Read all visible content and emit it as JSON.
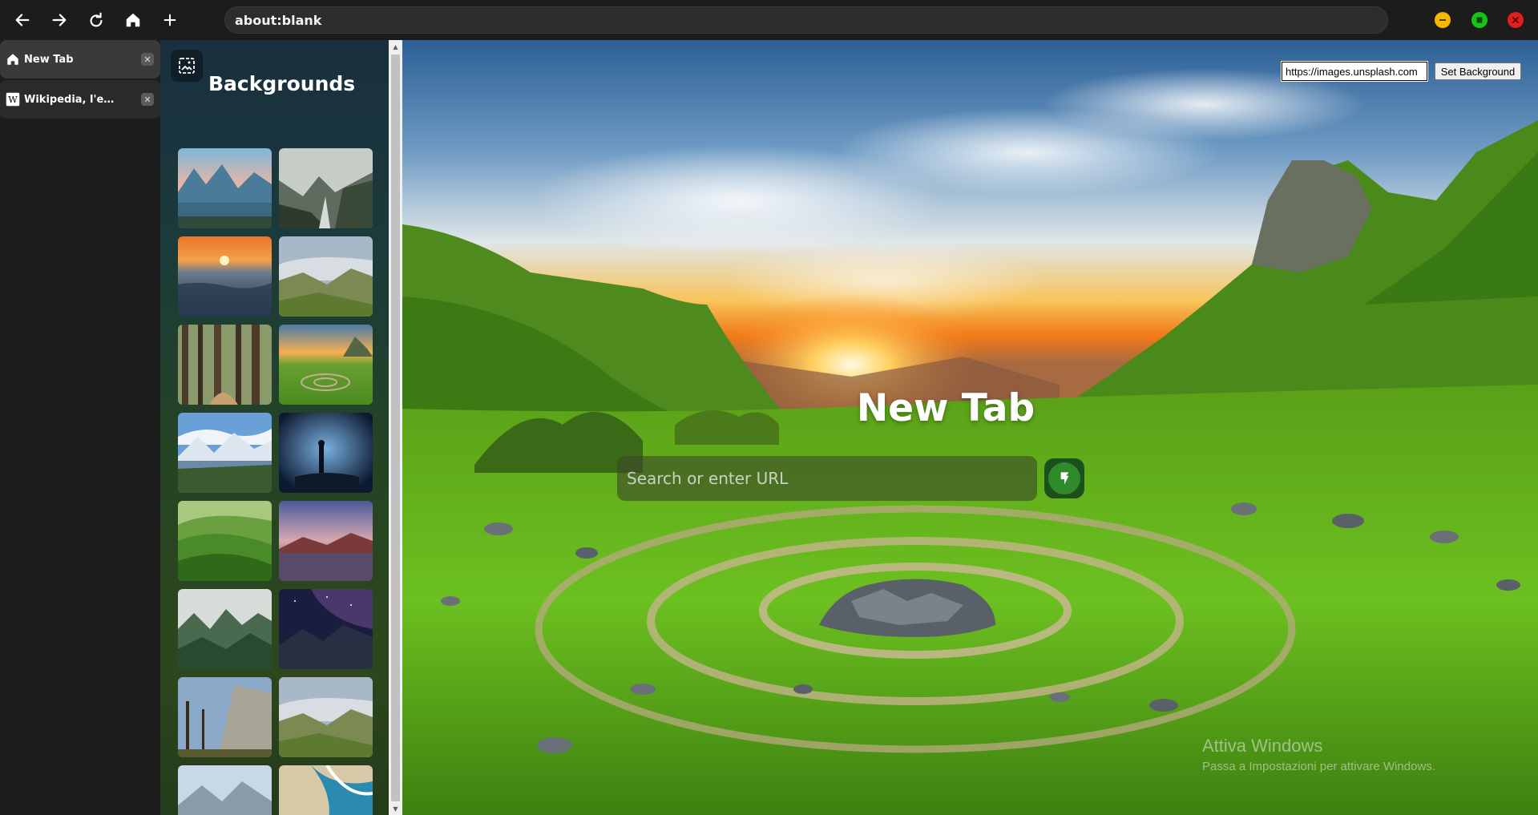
{
  "toolbar": {
    "address": "about:blank",
    "buttons": [
      "back-icon",
      "forward-icon",
      "reload-icon",
      "home-icon",
      "plus-icon"
    ],
    "window_controls": {
      "minimize_color": "#f5b800",
      "maximize_color": "#17c317",
      "close_color": "#e0201e"
    }
  },
  "tabs": [
    {
      "title": "New Tab",
      "icon": "home-icon",
      "active": true
    },
    {
      "title": "Wikipedia, l'enciclopedia libera",
      "icon": "wikipedia-icon",
      "active": false
    }
  ],
  "backgrounds_panel": {
    "title": "Backgrounds",
    "icon": "image-icon",
    "thumbnail_count": 16
  },
  "main": {
    "url_input_value": "https://images.unsplash.com",
    "set_background_label": "Set Background",
    "heading": "New Tab",
    "search_placeholder": "Search or enter URL",
    "go_icon": "engine-icon"
  },
  "watermark": {
    "title": "Attiva Windows",
    "subtitle": "Passa a Impostazioni per attivare Windows."
  },
  "colors": {
    "toolbar_bg": "#1c1c1c",
    "address_bg": "#2d2d2d",
    "active_tab_bg": "#3a3a3a",
    "go_button": "#2f8a2a"
  }
}
